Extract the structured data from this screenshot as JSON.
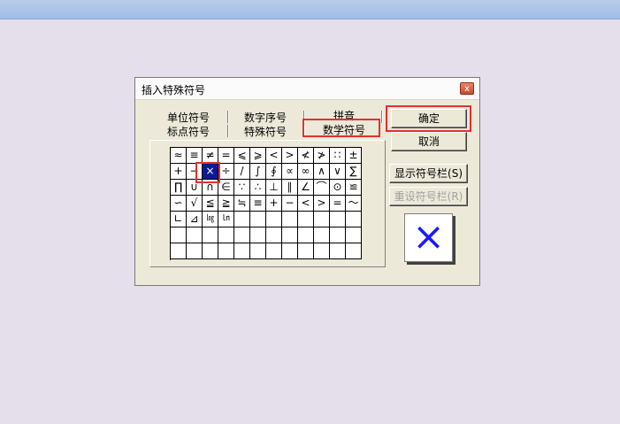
{
  "dialog": {
    "title": "插入特殊符号",
    "close_glyph": "x",
    "tabs_row1": [
      "单位符号",
      "数字序号",
      "拼音"
    ],
    "tabs_row2": [
      "标点符号",
      "特殊符号",
      "数学符号"
    ],
    "active_tab": "数学符号",
    "buttons": {
      "ok": "确定",
      "cancel": "取消",
      "show_bar": "显示符号栏",
      "show_bar_key": "(S)",
      "reset_bar": "重设符号栏",
      "reset_bar_key": "(R)"
    },
    "preview_symbol": "×",
    "selected_symbol": "×",
    "symbol_rows": [
      [
        "≈",
        "≡",
        "≠",
        "=",
        "⩽",
        "⩾",
        "<",
        ">",
        "≮",
        "≯",
        "∷",
        "±"
      ],
      [
        "+",
        "−",
        "×",
        "÷",
        "/",
        "∫",
        "∮",
        "∝",
        "∞",
        "∧",
        "∨",
        "∑"
      ],
      [
        "∏",
        "∪",
        "∩",
        "∈",
        "∵",
        "∴",
        "⊥",
        "∥",
        "∠",
        "⌒",
        "⊙",
        "≌"
      ],
      [
        "∽",
        "√",
        "≦",
        "≧",
        "≒",
        "≡",
        "+",
        "−",
        "<",
        ">",
        "=",
        "～"
      ],
      [
        "∟",
        "⊿",
        "㏒",
        "㏑",
        "",
        "",
        "",
        "",
        "",
        "",
        "",
        ""
      ],
      [
        "",
        "",
        "",
        "",
        "",
        "",
        "",
        "",
        "",
        "",
        "",
        ""
      ],
      [
        "",
        "",
        "",
        "",
        "",
        "",
        "",
        "",
        "",
        "",
        "",
        ""
      ]
    ]
  }
}
